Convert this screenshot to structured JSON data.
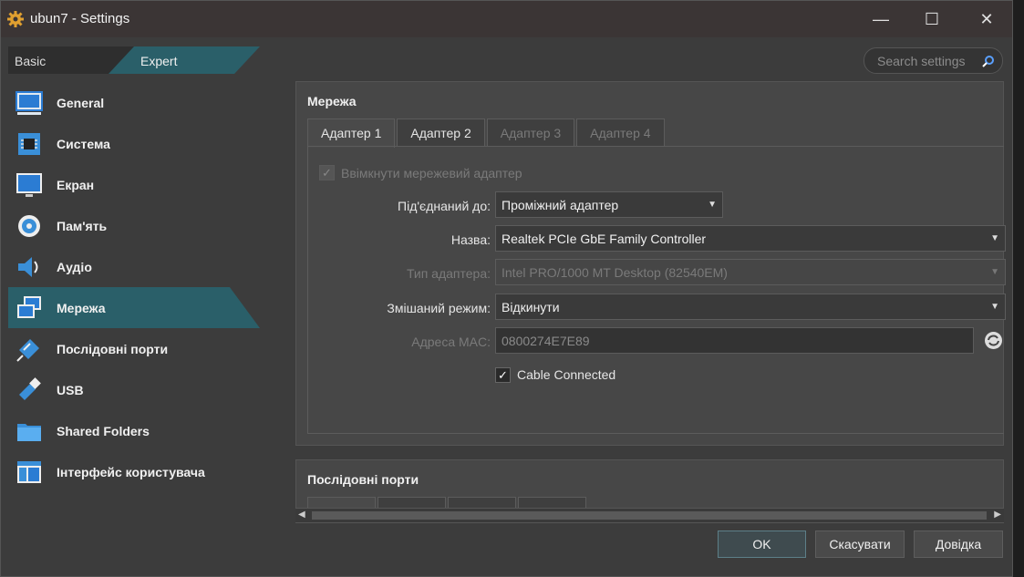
{
  "window": {
    "title": "ubun7 - Settings",
    "minimize": "—",
    "maximize": "☐",
    "close": "✕"
  },
  "mode": {
    "basic": "Basic",
    "expert": "Expert"
  },
  "search": {
    "placeholder": "Search settings"
  },
  "sidebar": {
    "items": [
      {
        "label": "General",
        "icon": "monitor-general-icon"
      },
      {
        "label": "Система",
        "icon": "motherboard-icon"
      },
      {
        "label": "Екран",
        "icon": "display-icon"
      },
      {
        "label": "Пам'ять",
        "icon": "storage-icon"
      },
      {
        "label": "Аудіо",
        "icon": "speaker-icon"
      },
      {
        "label": "Мережа",
        "icon": "network-icon"
      },
      {
        "label": "Послідовні порти",
        "icon": "serial-port-icon"
      },
      {
        "label": "USB",
        "icon": "usb-icon"
      },
      {
        "label": "Shared Folders",
        "icon": "folder-icon"
      },
      {
        "label": "Інтерфейс користувача",
        "icon": "ui-window-icon"
      }
    ],
    "active_index": 5
  },
  "network": {
    "title": "Мережа",
    "tabs": [
      "Адаптер 1",
      "Адаптер 2",
      "Адаптер 3",
      "Адаптер 4"
    ],
    "enable_label": "Ввімкнути мережевий адаптер",
    "attached_label": "Під'єднаний до:",
    "attached_value": "Проміжний адаптер",
    "name_label": "Назва:",
    "name_value": "Realtek PCIe GbE Family Controller",
    "type_label": "Тип адаптера:",
    "type_value": "Intel PRO/1000 MT Desktop (82540EM)",
    "promisc_label": "Змішаний режим:",
    "promisc_value": "Відкинути",
    "mac_label": "Адреса MAC:",
    "mac_value": "0800274E7E89",
    "cable_label": "Cable Connected"
  },
  "serial": {
    "title": "Послідовні порти"
  },
  "buttons": {
    "ok": "OK",
    "cancel": "Скасувати",
    "help": "Довідка"
  },
  "colors": {
    "accent": "#2a5f69",
    "background": "#3c3c3c"
  }
}
